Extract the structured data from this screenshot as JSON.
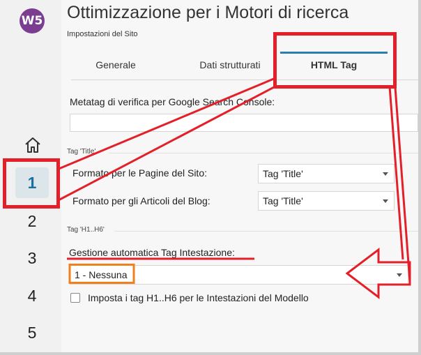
{
  "app": {
    "logo_text": "W5"
  },
  "sidebar": {
    "steps": [
      {
        "label": "1",
        "active": true
      },
      {
        "label": "2"
      },
      {
        "label": "3"
      },
      {
        "label": "4"
      },
      {
        "label": "5"
      }
    ]
  },
  "header": {
    "title": "Ottimizzazione per i Motori di ricerca",
    "subtitle": "Impostazioni del Sito"
  },
  "tabs": [
    {
      "label": "Generale"
    },
    {
      "label": "Dati strutturati"
    },
    {
      "label": "HTML Tag",
      "active": true
    }
  ],
  "form": {
    "verification_label": "Metatag di verifica per Google Search Console:",
    "verification_value": "",
    "title_section": "Tag 'Title'",
    "pages_format_label": "Formato per le Pagine del Sito:",
    "pages_format_value": "Tag 'Title'",
    "blog_format_label": "Formato per gli Articoli del Blog:",
    "blog_format_value": "Tag 'Title'",
    "heading_section": "Tag 'H1..H6'",
    "auto_heading_label": "Gestione automatica Tag Intestazione:",
    "auto_heading_value": "1 - Nessuna",
    "template_headings_label": "Imposta i tag H1..H6 per le Intestazioni del Modello",
    "template_headings_checked": false
  },
  "annotation_colors": {
    "red": "#e3202a",
    "orange": "#f07f1e"
  }
}
